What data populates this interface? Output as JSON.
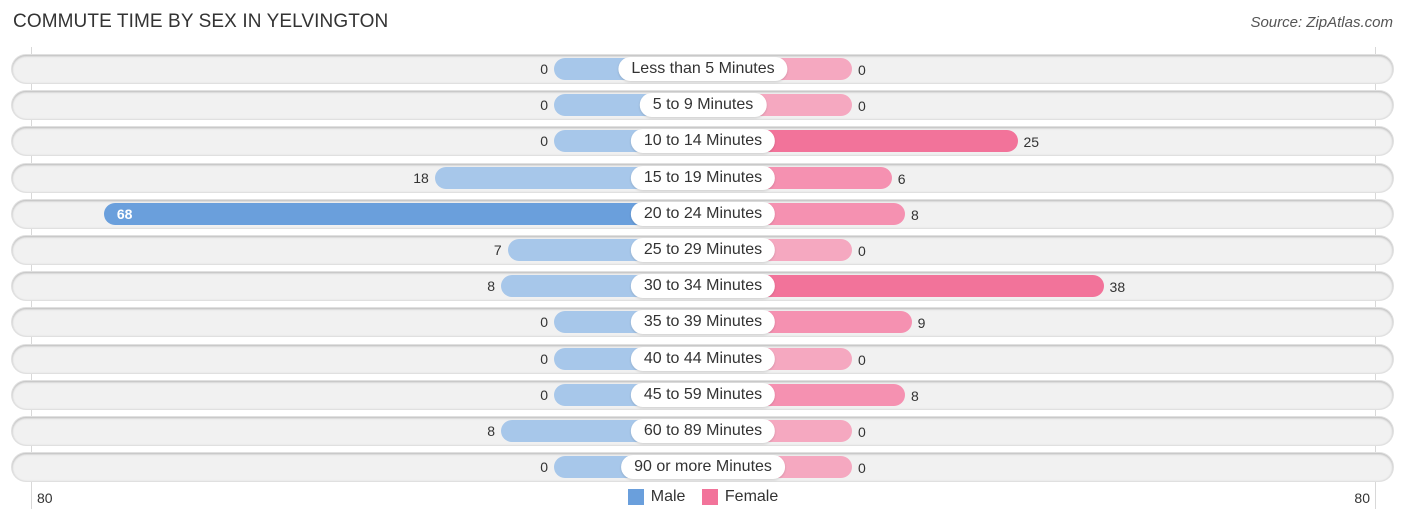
{
  "chart_data": {
    "type": "bar",
    "orientation": "horizontal-diverging",
    "title": "COMMUTE TIME BY SEX IN YELVINGTON",
    "source": "Source: ZipAtlas.com",
    "categories": [
      "Less than 5 Minutes",
      "5 to 9 Minutes",
      "10 to 14 Minutes",
      "15 to 19 Minutes",
      "20 to 24 Minutes",
      "25 to 29 Minutes",
      "30 to 34 Minutes",
      "35 to 39 Minutes",
      "40 to 44 Minutes",
      "45 to 59 Minutes",
      "60 to 89 Minutes",
      "90 or more Minutes"
    ],
    "series": [
      {
        "name": "Male",
        "color": "#6a9fdc",
        "values": [
          0,
          0,
          0,
          18,
          68,
          7,
          8,
          0,
          0,
          0,
          8,
          0
        ]
      },
      {
        "name": "Female",
        "color": "#f2739a",
        "values": [
          0,
          0,
          25,
          6,
          8,
          0,
          38,
          9,
          0,
          8,
          0,
          0
        ]
      }
    ],
    "axis": {
      "left_tick": "80",
      "right_tick": "80",
      "range": [
        -80,
        80
      ]
    },
    "legend": {
      "placement": "bottom-center",
      "entries": [
        "Male",
        "Female"
      ]
    }
  }
}
